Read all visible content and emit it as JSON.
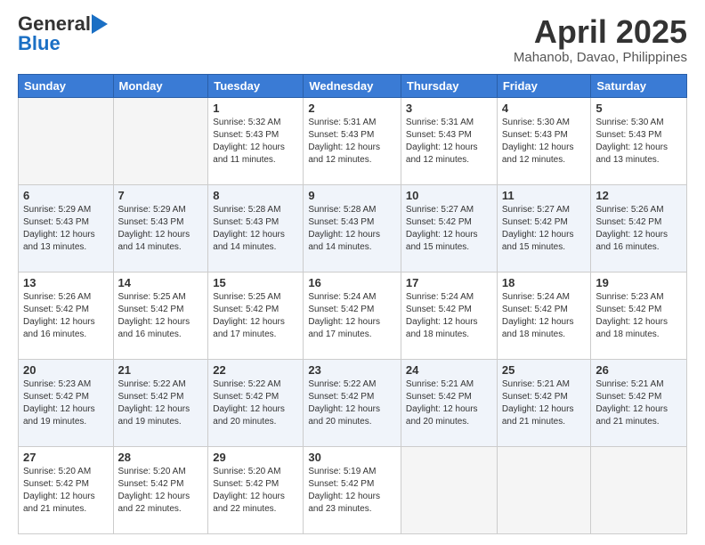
{
  "logo": {
    "general": "General",
    "blue": "Blue"
  },
  "header": {
    "month": "April 2025",
    "location": "Mahanob, Davao, Philippines"
  },
  "weekdays": [
    "Sunday",
    "Monday",
    "Tuesday",
    "Wednesday",
    "Thursday",
    "Friday",
    "Saturday"
  ],
  "weeks": [
    [
      {
        "day": "",
        "sunrise": "",
        "sunset": "",
        "daylight": ""
      },
      {
        "day": "",
        "sunrise": "",
        "sunset": "",
        "daylight": ""
      },
      {
        "day": "1",
        "sunrise": "Sunrise: 5:32 AM",
        "sunset": "Sunset: 5:43 PM",
        "daylight": "Daylight: 12 hours and 11 minutes."
      },
      {
        "day": "2",
        "sunrise": "Sunrise: 5:31 AM",
        "sunset": "Sunset: 5:43 PM",
        "daylight": "Daylight: 12 hours and 12 minutes."
      },
      {
        "day": "3",
        "sunrise": "Sunrise: 5:31 AM",
        "sunset": "Sunset: 5:43 PM",
        "daylight": "Daylight: 12 hours and 12 minutes."
      },
      {
        "day": "4",
        "sunrise": "Sunrise: 5:30 AM",
        "sunset": "Sunset: 5:43 PM",
        "daylight": "Daylight: 12 hours and 12 minutes."
      },
      {
        "day": "5",
        "sunrise": "Sunrise: 5:30 AM",
        "sunset": "Sunset: 5:43 PM",
        "daylight": "Daylight: 12 hours and 13 minutes."
      }
    ],
    [
      {
        "day": "6",
        "sunrise": "Sunrise: 5:29 AM",
        "sunset": "Sunset: 5:43 PM",
        "daylight": "Daylight: 12 hours and 13 minutes."
      },
      {
        "day": "7",
        "sunrise": "Sunrise: 5:29 AM",
        "sunset": "Sunset: 5:43 PM",
        "daylight": "Daylight: 12 hours and 14 minutes."
      },
      {
        "day": "8",
        "sunrise": "Sunrise: 5:28 AM",
        "sunset": "Sunset: 5:43 PM",
        "daylight": "Daylight: 12 hours and 14 minutes."
      },
      {
        "day": "9",
        "sunrise": "Sunrise: 5:28 AM",
        "sunset": "Sunset: 5:43 PM",
        "daylight": "Daylight: 12 hours and 14 minutes."
      },
      {
        "day": "10",
        "sunrise": "Sunrise: 5:27 AM",
        "sunset": "Sunset: 5:42 PM",
        "daylight": "Daylight: 12 hours and 15 minutes."
      },
      {
        "day": "11",
        "sunrise": "Sunrise: 5:27 AM",
        "sunset": "Sunset: 5:42 PM",
        "daylight": "Daylight: 12 hours and 15 minutes."
      },
      {
        "day": "12",
        "sunrise": "Sunrise: 5:26 AM",
        "sunset": "Sunset: 5:42 PM",
        "daylight": "Daylight: 12 hours and 16 minutes."
      }
    ],
    [
      {
        "day": "13",
        "sunrise": "Sunrise: 5:26 AM",
        "sunset": "Sunset: 5:42 PM",
        "daylight": "Daylight: 12 hours and 16 minutes."
      },
      {
        "day": "14",
        "sunrise": "Sunrise: 5:25 AM",
        "sunset": "Sunset: 5:42 PM",
        "daylight": "Daylight: 12 hours and 16 minutes."
      },
      {
        "day": "15",
        "sunrise": "Sunrise: 5:25 AM",
        "sunset": "Sunset: 5:42 PM",
        "daylight": "Daylight: 12 hours and 17 minutes."
      },
      {
        "day": "16",
        "sunrise": "Sunrise: 5:24 AM",
        "sunset": "Sunset: 5:42 PM",
        "daylight": "Daylight: 12 hours and 17 minutes."
      },
      {
        "day": "17",
        "sunrise": "Sunrise: 5:24 AM",
        "sunset": "Sunset: 5:42 PM",
        "daylight": "Daylight: 12 hours and 18 minutes."
      },
      {
        "day": "18",
        "sunrise": "Sunrise: 5:24 AM",
        "sunset": "Sunset: 5:42 PM",
        "daylight": "Daylight: 12 hours and 18 minutes."
      },
      {
        "day": "19",
        "sunrise": "Sunrise: 5:23 AM",
        "sunset": "Sunset: 5:42 PM",
        "daylight": "Daylight: 12 hours and 18 minutes."
      }
    ],
    [
      {
        "day": "20",
        "sunrise": "Sunrise: 5:23 AM",
        "sunset": "Sunset: 5:42 PM",
        "daylight": "Daylight: 12 hours and 19 minutes."
      },
      {
        "day": "21",
        "sunrise": "Sunrise: 5:22 AM",
        "sunset": "Sunset: 5:42 PM",
        "daylight": "Daylight: 12 hours and 19 minutes."
      },
      {
        "day": "22",
        "sunrise": "Sunrise: 5:22 AM",
        "sunset": "Sunset: 5:42 PM",
        "daylight": "Daylight: 12 hours and 20 minutes."
      },
      {
        "day": "23",
        "sunrise": "Sunrise: 5:22 AM",
        "sunset": "Sunset: 5:42 PM",
        "daylight": "Daylight: 12 hours and 20 minutes."
      },
      {
        "day": "24",
        "sunrise": "Sunrise: 5:21 AM",
        "sunset": "Sunset: 5:42 PM",
        "daylight": "Daylight: 12 hours and 20 minutes."
      },
      {
        "day": "25",
        "sunrise": "Sunrise: 5:21 AM",
        "sunset": "Sunset: 5:42 PM",
        "daylight": "Daylight: 12 hours and 21 minutes."
      },
      {
        "day": "26",
        "sunrise": "Sunrise: 5:21 AM",
        "sunset": "Sunset: 5:42 PM",
        "daylight": "Daylight: 12 hours and 21 minutes."
      }
    ],
    [
      {
        "day": "27",
        "sunrise": "Sunrise: 5:20 AM",
        "sunset": "Sunset: 5:42 PM",
        "daylight": "Daylight: 12 hours and 21 minutes."
      },
      {
        "day": "28",
        "sunrise": "Sunrise: 5:20 AM",
        "sunset": "Sunset: 5:42 PM",
        "daylight": "Daylight: 12 hours and 22 minutes."
      },
      {
        "day": "29",
        "sunrise": "Sunrise: 5:20 AM",
        "sunset": "Sunset: 5:42 PM",
        "daylight": "Daylight: 12 hours and 22 minutes."
      },
      {
        "day": "30",
        "sunrise": "Sunrise: 5:19 AM",
        "sunset": "Sunset: 5:42 PM",
        "daylight": "Daylight: 12 hours and 23 minutes."
      },
      {
        "day": "",
        "sunrise": "",
        "sunset": "",
        "daylight": ""
      },
      {
        "day": "",
        "sunrise": "",
        "sunset": "",
        "daylight": ""
      },
      {
        "day": "",
        "sunrise": "",
        "sunset": "",
        "daylight": ""
      }
    ]
  ]
}
